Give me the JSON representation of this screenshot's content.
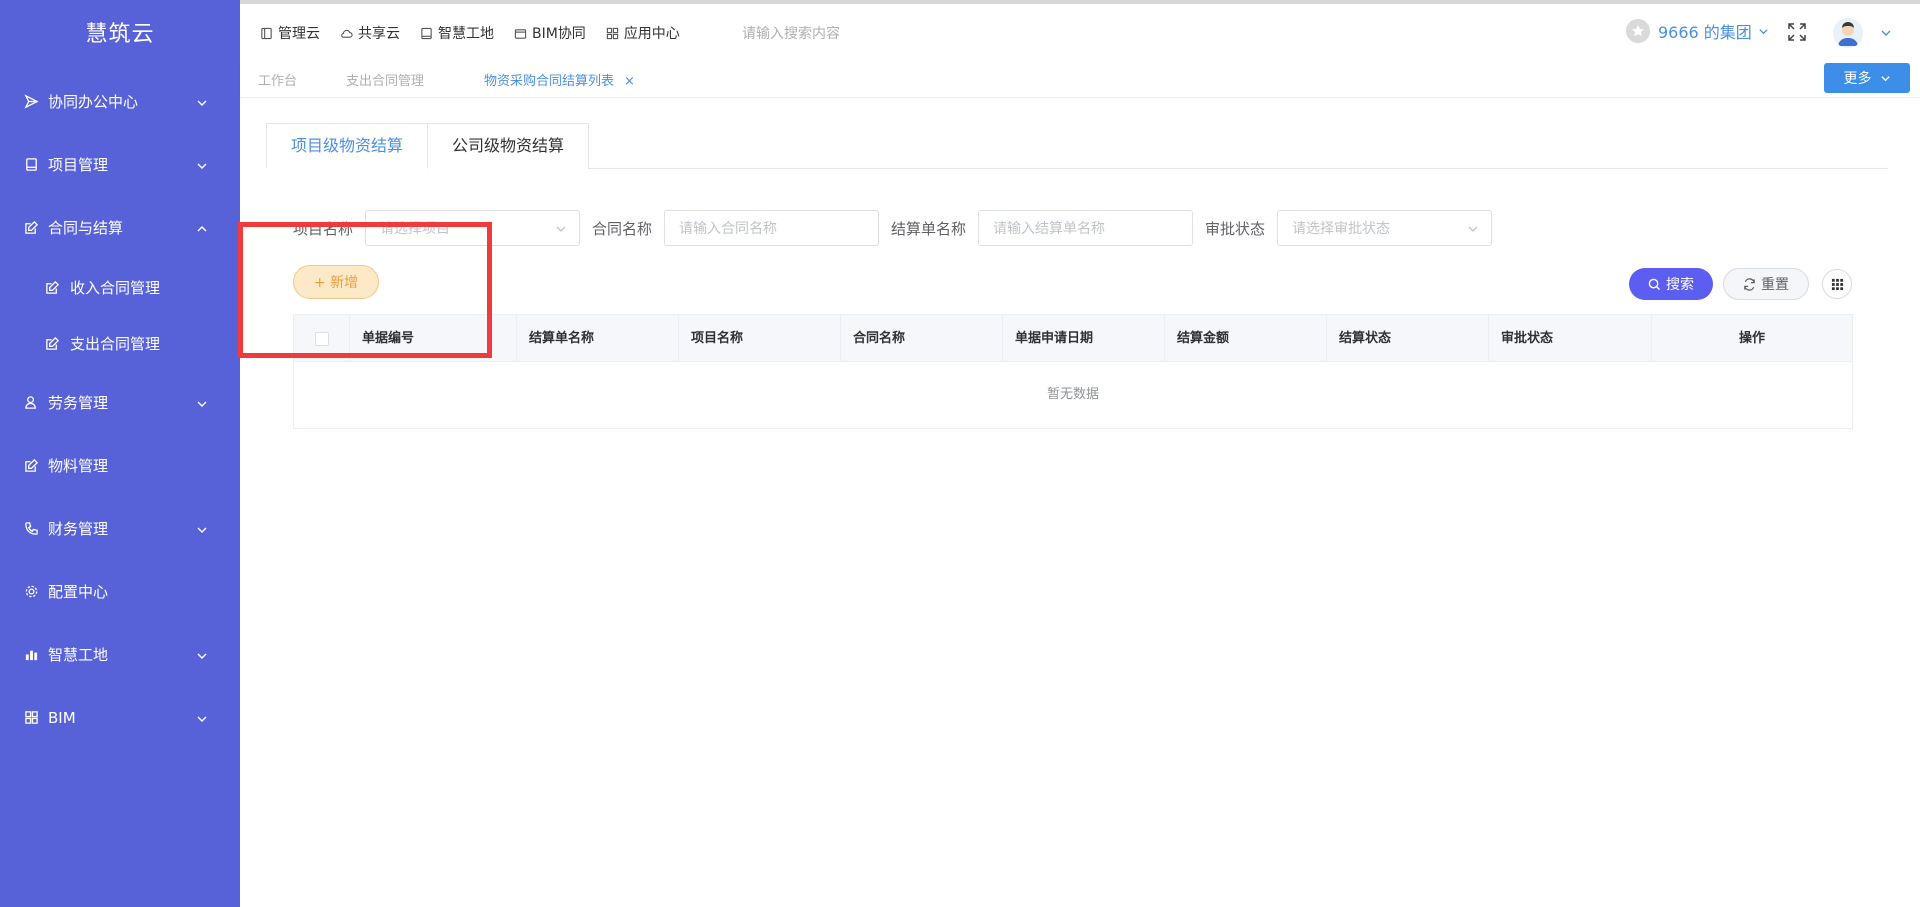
{
  "brand": "慧筑云",
  "sidebar": {
    "items": [
      {
        "label": "协同办公中心",
        "icon": "send-icon",
        "expandable": true,
        "expanded": false
      },
      {
        "label": "项目管理",
        "icon": "book-icon",
        "expandable": true,
        "expanded": false
      },
      {
        "label": "合同与结算",
        "icon": "edit-icon",
        "expandable": true,
        "expanded": true
      },
      {
        "label": "劳务管理",
        "icon": "user-icon",
        "expandable": true,
        "expanded": false
      },
      {
        "label": "物料管理",
        "icon": "edit-icon",
        "expandable": false
      },
      {
        "label": "财务管理",
        "icon": "phone-icon",
        "expandable": true,
        "expanded": false
      },
      {
        "label": "配置中心",
        "icon": "gear-icon",
        "expandable": false
      },
      {
        "label": "智慧工地",
        "icon": "bar-chart-icon",
        "expandable": true,
        "expanded": false
      },
      {
        "label": "BIM",
        "icon": "grid-icon",
        "expandable": true,
        "expanded": false
      }
    ],
    "subitems": [
      {
        "label": "收入合同管理",
        "icon": "edit-icon"
      },
      {
        "label": "支出合同管理",
        "icon": "edit-icon"
      }
    ]
  },
  "topnav": {
    "items": [
      {
        "label": "管理云",
        "icon": "book-icon"
      },
      {
        "label": "共享云",
        "icon": "cloud-icon"
      },
      {
        "label": "智慧工地",
        "icon": "book-icon"
      },
      {
        "label": "BIM协同",
        "icon": "folder-icon"
      },
      {
        "label": "应用中心",
        "icon": "grid-icon"
      }
    ],
    "search_placeholder": "请输入搜索内容",
    "org_name": "9666 的集团"
  },
  "tags": {
    "items": [
      "工作台",
      "支出合同管理",
      "物资采购合同结算列表"
    ],
    "active_index": 2,
    "close_symbol": "×",
    "more_label": "更多"
  },
  "main": {
    "tabs": [
      "项目级物资结算",
      "公司级物资结算"
    ],
    "active_tab": 0,
    "filters": {
      "project_label": "项目名称",
      "project_placeholder": "请选择项目",
      "contract_label": "合同名称",
      "contract_placeholder": "请输入合同名称",
      "settlement_label": "结算单名称",
      "settlement_placeholder": "请输入结算单名称",
      "approval_label": "审批状态",
      "approval_placeholder": "请选择审批状态"
    },
    "add_label": "+ 新增",
    "search_label": "搜索",
    "reset_label": "重置",
    "table": {
      "columns": [
        "单据编号",
        "结算单名称",
        "项目名称",
        "合同名称",
        "单据申请日期",
        "结算金额",
        "结算状态",
        "审批状态",
        "操作"
      ],
      "empty_text": "暂无数据"
    }
  },
  "colors": {
    "sidebar_bg": "#5862d8",
    "primary_blue": "#3d8ee8",
    "search_button": "#5b5ef0",
    "add_button_bg": "#fde9c8",
    "add_button_text": "#e6a23c",
    "highlight_box": "#ef3b3b"
  }
}
